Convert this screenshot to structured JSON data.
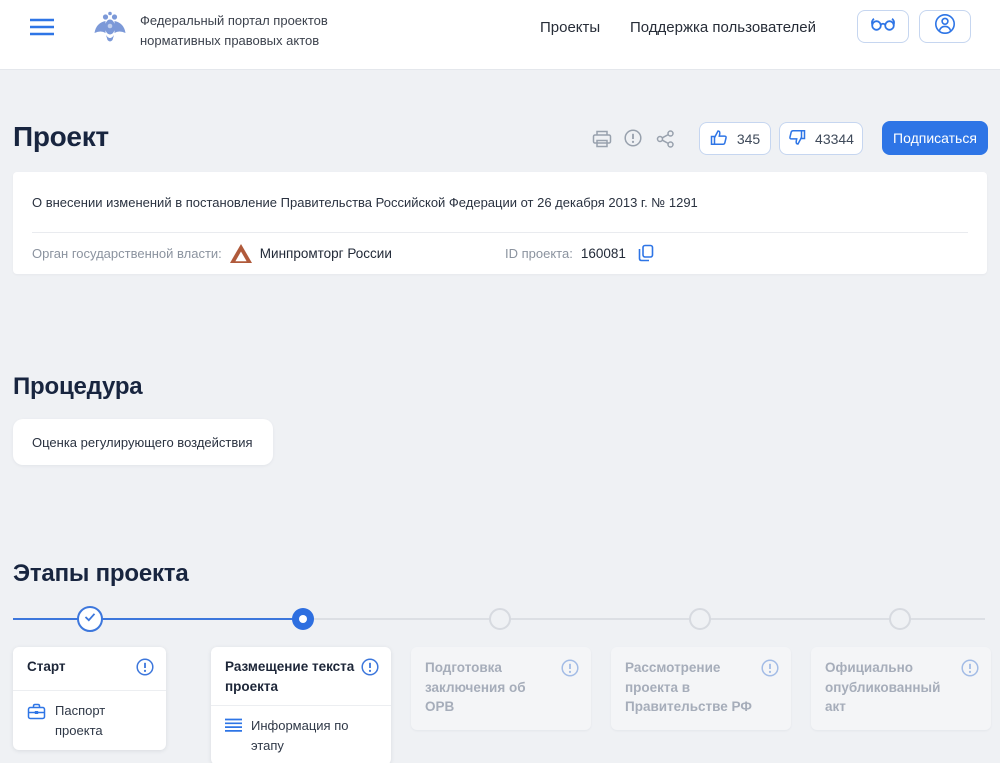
{
  "header": {
    "portal_title": "Федеральный портал проектов нормативных правовых актов",
    "nav_projects": "Проекты",
    "nav_support": "Поддержка пользователей"
  },
  "project": {
    "section_title": "Проект",
    "likes_count": "345",
    "dislikes_count": "43344",
    "subscribe_label": "Подписаться",
    "name": "О внесении изменений в постановление Правительства Российской Федерации от 26 декабря 2013 г. № 1291",
    "authority_label": "Орган государственной власти:",
    "authority_name": "Минпромторг России",
    "project_id_label": "ID проекта:",
    "project_id": "160081"
  },
  "procedure": {
    "section_title": "Процедура",
    "type": "Оценка регулирующего воздействия"
  },
  "stages": {
    "section_title": "Этапы проекта",
    "items": [
      {
        "title": "Старт",
        "state": "done",
        "link": "Паспорт проекта"
      },
      {
        "title": "Размещение текста проекта",
        "state": "active",
        "link": "Информация по этапу"
      },
      {
        "title": "Подготовка заключения об ОРВ",
        "state": "pending"
      },
      {
        "title": "Рассмотрение проекта в Правительстве РФ",
        "state": "pending"
      },
      {
        "title": "Официально опубликованный акт",
        "state": "pending"
      }
    ]
  },
  "colors": {
    "accent_blue": "#2e75e6",
    "stepper_blue": "#3d77dc",
    "dark_text": "#18253f",
    "gray_text": "#8b939f",
    "page_bg": "#eff1f4",
    "authority_logo_brown": "#b05a3b"
  }
}
